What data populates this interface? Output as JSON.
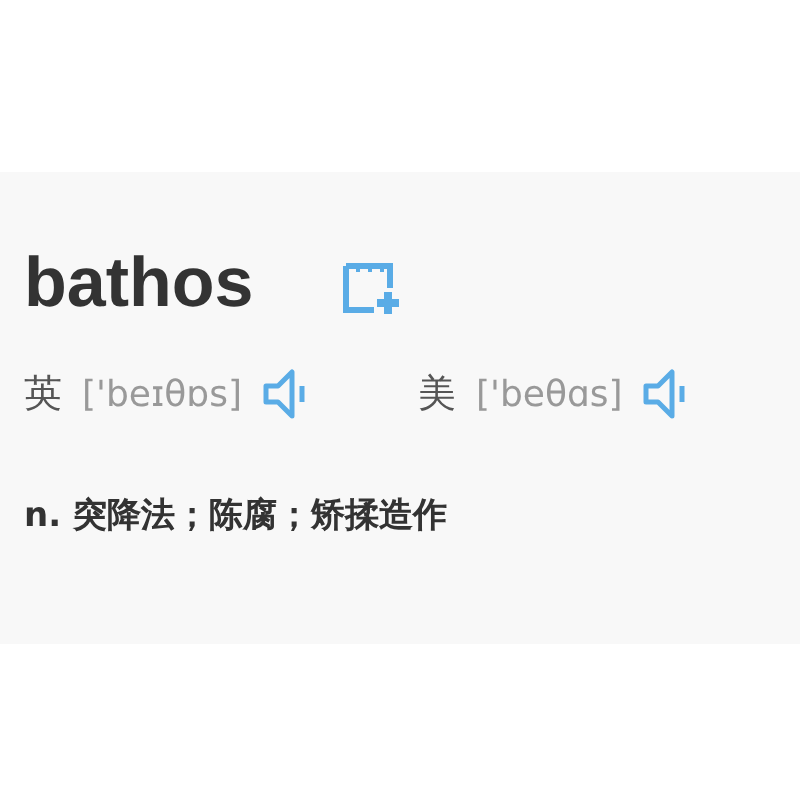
{
  "word": "bathos",
  "pronunciations": [
    {
      "region": "英",
      "phonetic": "['beɪθɒs]"
    },
    {
      "region": "美",
      "phonetic": "['beθɑs]"
    }
  ],
  "definition": "n. 突降法；陈腐；矫揉造作"
}
